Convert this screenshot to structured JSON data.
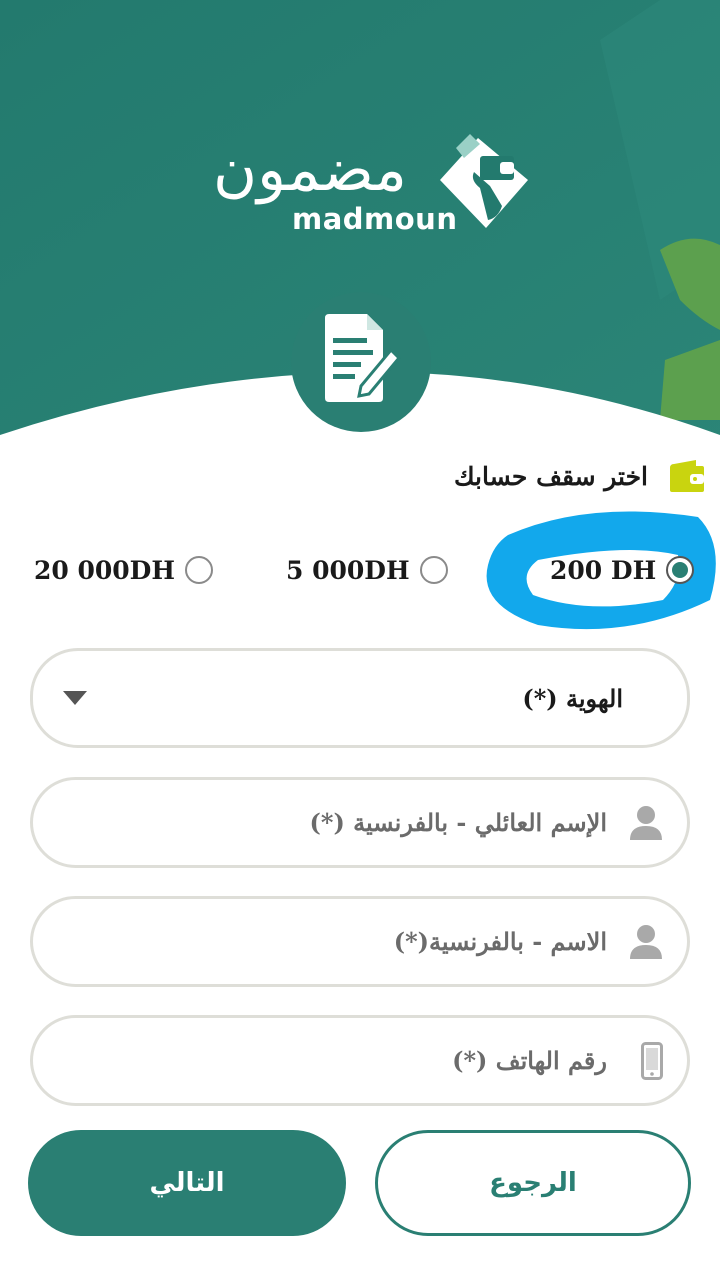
{
  "colors": {
    "primary": "#2a7f73",
    "header_bg": "#237a6e",
    "accent_green": "#5ca04e",
    "wallet_lime": "#c9d40f",
    "highlight_blue": "#12a8ec",
    "field_border": "#deded8"
  },
  "brand": {
    "arabic_name": "مضمون",
    "latin_name": "madmoun"
  },
  "limit_section": {
    "title": "اختر سقف حسابك",
    "icon": "wallet-icon",
    "options": [
      {
        "label": "200 DH",
        "selected": true
      },
      {
        "label": "5 000DH",
        "selected": false
      },
      {
        "label": "20 000DH",
        "selected": false
      }
    ]
  },
  "form": {
    "identity": {
      "value": "الهوية (*)",
      "icon": "chevron-down-icon"
    },
    "last_name": {
      "placeholder": "الإسم العائلي - بالفرنسية (*)",
      "icon": "user-icon"
    },
    "first_name": {
      "placeholder": "الاسم - بالفرنسية(*)",
      "icon": "user-icon"
    },
    "phone": {
      "placeholder": "رقم الهاتف (*)",
      "icon": "phone-icon"
    }
  },
  "buttons": {
    "next": "التالي",
    "back": "الرجوع"
  }
}
